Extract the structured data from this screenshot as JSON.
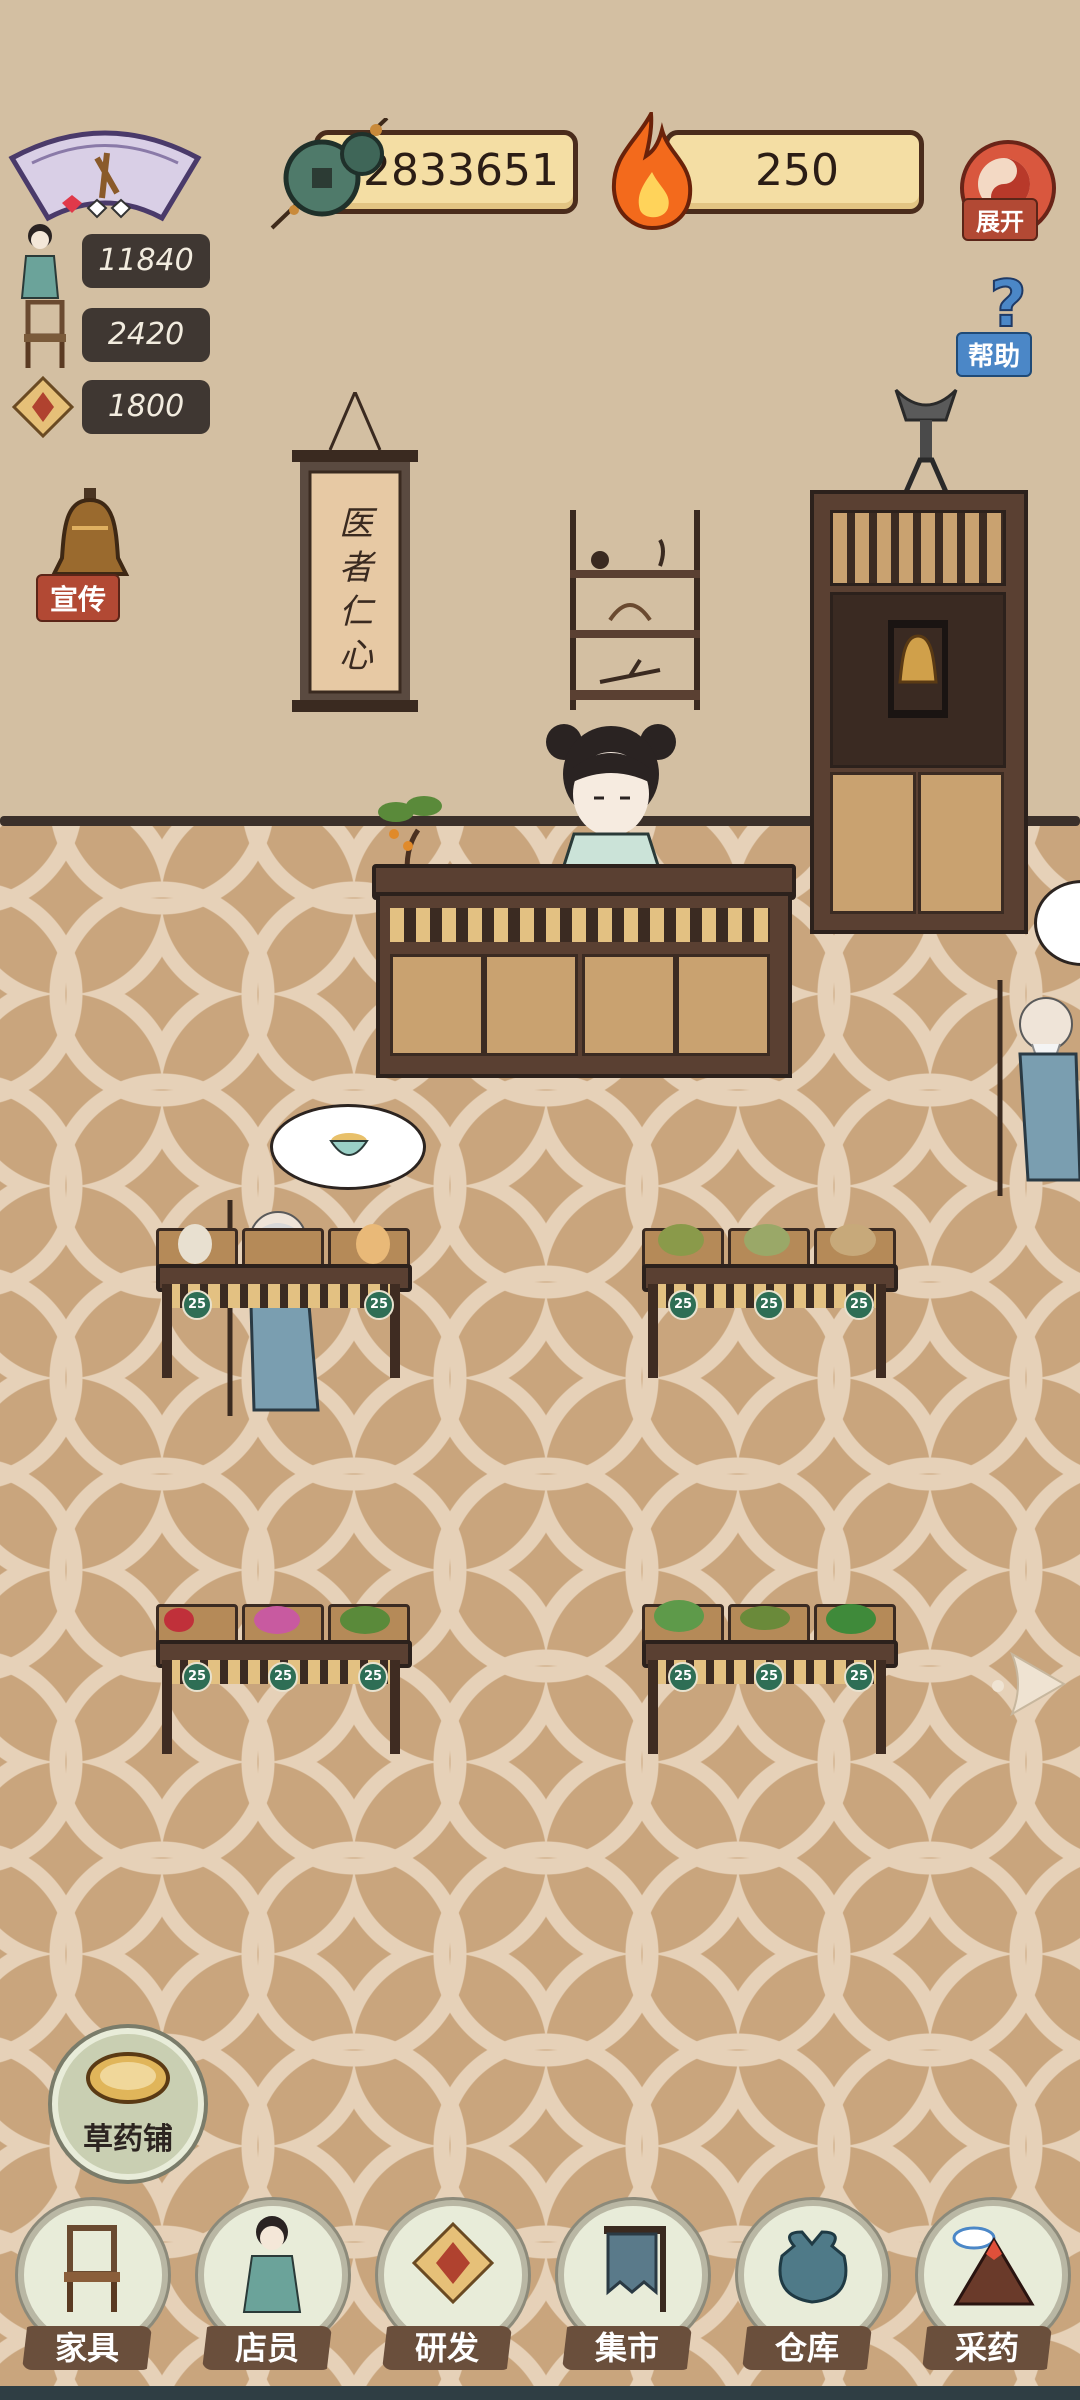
{
  "resources": {
    "coins": "72833651",
    "fire": "250"
  },
  "top_buttons": {
    "expand": "展开",
    "help": "帮助"
  },
  "left_stats": {
    "staff": "11840",
    "furniture": "2420",
    "research": "1800"
  },
  "promote_label": "宣传",
  "scroll_text": "医者仁心",
  "table_badge": "25",
  "shop_name": "草药铺",
  "nav": [
    {
      "label": "家具",
      "icon": "chair-icon"
    },
    {
      "label": "店员",
      "icon": "shop-assistant-icon"
    },
    {
      "label": "研发",
      "icon": "research-package-icon"
    },
    {
      "label": "集市",
      "icon": "market-banner-icon"
    },
    {
      "label": "仓库",
      "icon": "warehouse-bag-icon"
    },
    {
      "label": "采药",
      "icon": "mountain-icon"
    }
  ],
  "colors": {
    "wall": "#d3bfa2",
    "floor": "#c9a57d",
    "bar_fill": "#f4dea4",
    "tag_red": "#b24934",
    "tag_blue": "#4b87c7"
  }
}
